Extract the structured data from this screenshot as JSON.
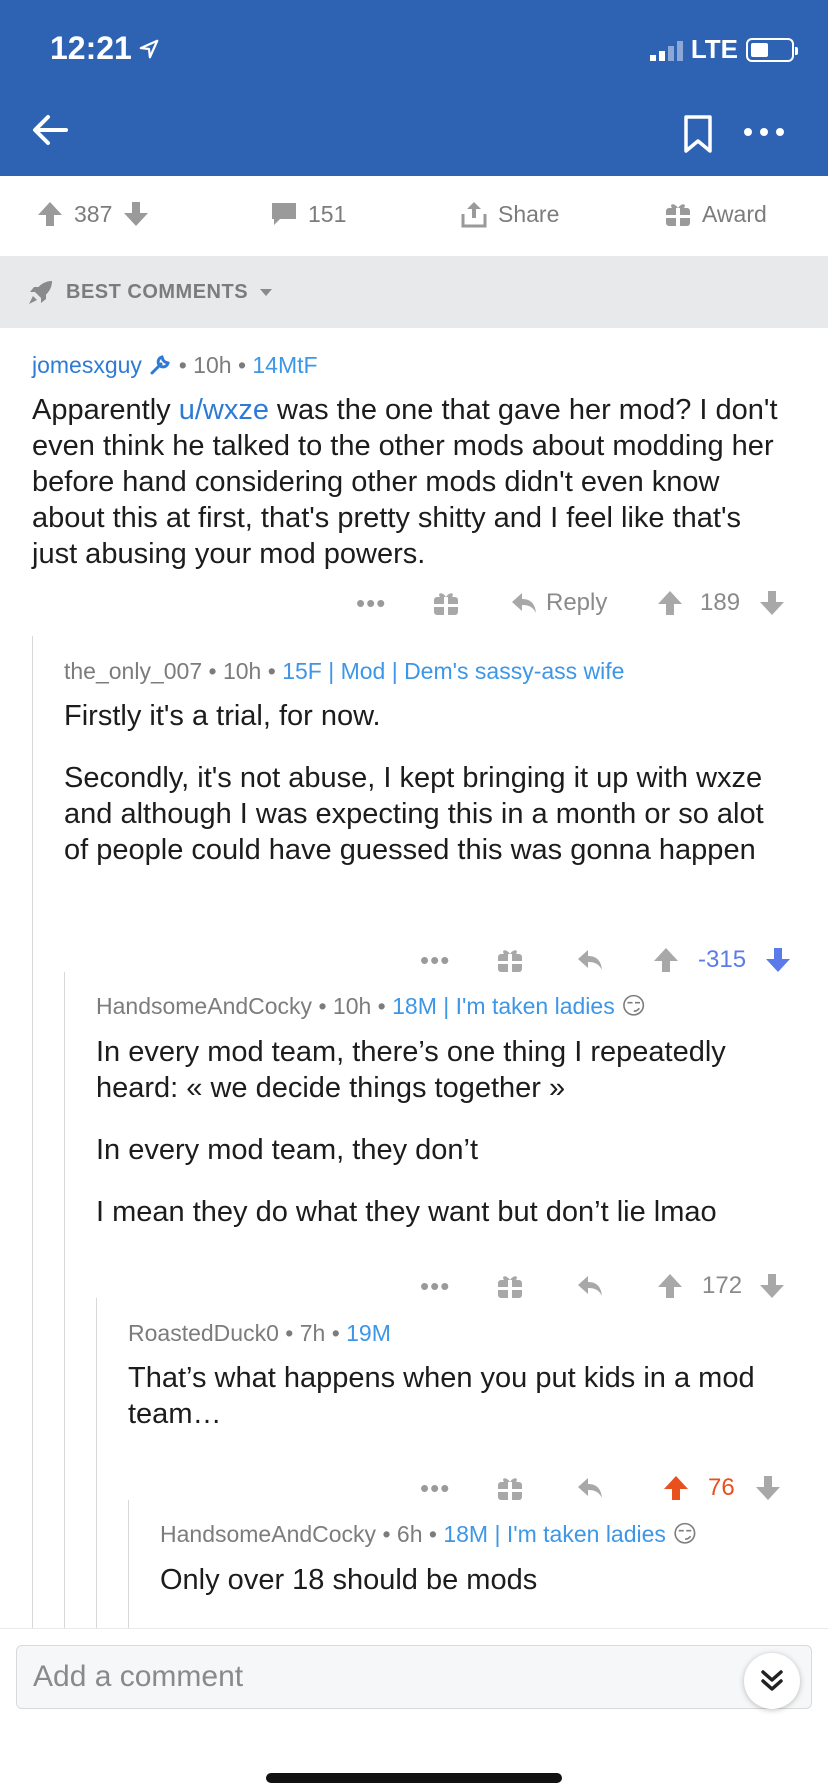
{
  "status": {
    "time": "12:21",
    "network": "LTE"
  },
  "post_actions": {
    "score": "387",
    "comments": "151",
    "share_label": "Share",
    "award_label": "Award"
  },
  "sort": {
    "label": "BEST COMMENTS"
  },
  "comments": [
    {
      "author": "jomesxguy",
      "age": "10h",
      "flair": "14MtF",
      "body_pre": "Apparently ",
      "body_link": "u/wxze",
      "body_post": " was the one that gave her mod? I don't even think he talked to the other mods about modding her before hand considering other mods didn't even know about this at first, that's pretty shitty and I feel like that's just abusing your mod powers.",
      "reply_label": "Reply",
      "score": "189"
    },
    {
      "author": "the_only_007",
      "age": "10h",
      "flair": "15F | Mod | Dem's sassy-ass wife",
      "paragraphs": [
        "Firstly it's a trial, for now.",
        "Secondly, it's not abuse, I kept bringing it up with wxze and although I was expecting this in a month or so alot of people could have guessed this was gonna happen"
      ],
      "score": "-315"
    },
    {
      "author": "HandsomeAndCocky",
      "age": "10h",
      "flair": "18M | I'm taken ladies",
      "paragraphs": [
        "In every mod team, there’s one thing I repeatedly heard: « we decide things together »",
        "In every mod team, they don’t",
        "I mean they do what they want but don’t lie lmao"
      ],
      "score": "172"
    },
    {
      "author": "RoastedDuck0",
      "age": "7h",
      "flair": "19M",
      "paragraphs": [
        "That’s what happens when you put kids in a mod team…"
      ],
      "score": "76"
    },
    {
      "author": "HandsomeAndCocky",
      "age": "6h",
      "flair": "18M | I'm taken ladies",
      "paragraphs": [
        "Only over 18 should be mods"
      ]
    }
  ],
  "composer": {
    "placeholder": "Add a comment"
  },
  "colors": {
    "header": "#2e63b4",
    "link": "#2e7bd6",
    "flair": "#3d96e6",
    "downvote": "#5b7be9",
    "upvote": "#e8501e"
  },
  "icons": [
    "back-arrow-icon",
    "bookmark-icon",
    "more-icon",
    "upvote-icon",
    "downvote-icon",
    "comment-icon",
    "share-icon",
    "award-icon",
    "rocket-icon",
    "reply-icon",
    "collapse-icon"
  ]
}
